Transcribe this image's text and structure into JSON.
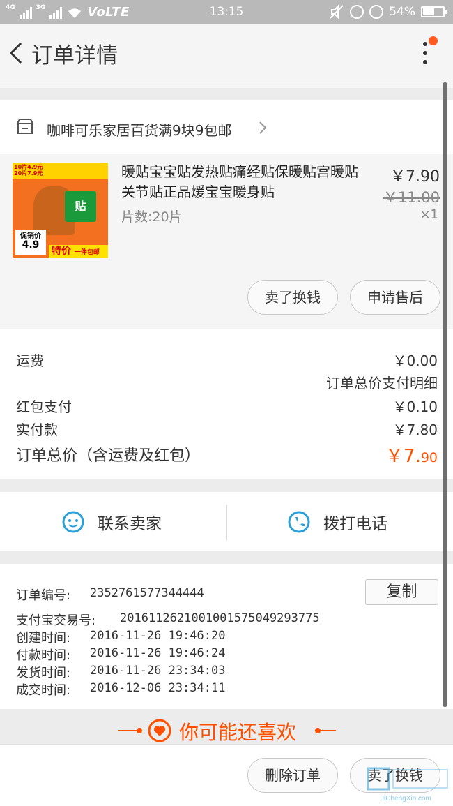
{
  "status_bar": {
    "network_left": "4G",
    "network_right": "3G",
    "volte": "VoLTE",
    "time": "13:15",
    "battery": "54%",
    "battery_level": 0.54
  },
  "header": {
    "title": "订单详情"
  },
  "shop": {
    "name": "咖啡可乐家居百货满9块9包邮"
  },
  "product": {
    "image_texts": {
      "line1": "10片4.9元",
      "line2": "20片7.9元",
      "brand": "智暖家族",
      "tie": "贴",
      "promo_label": "促销价",
      "promo_price": "4.9",
      "special": "特价",
      "special_sub": "一件包邮"
    },
    "title": "暖贴宝宝贴发热贴痛经贴保暖贴宫暖贴关节贴正品煖宝宝暖身贴",
    "spec": "片数:20片",
    "price": "￥7.90",
    "original_price": "￥11.00",
    "quantity": "×1",
    "sell_button": "卖了换钱",
    "refund_button": "申请售后"
  },
  "totals": {
    "shipping_label": "运费",
    "shipping_value": "￥0.00",
    "detail_link": "订单总价支付明细",
    "redpacket_label": "红包支付",
    "redpacket_value": "￥0.10",
    "paid_label": "实付款",
    "paid_value": "￥7.80",
    "total_label": "订单总价（含运费及红包）",
    "total_value_main": "￥7.",
    "total_value_cents": "90",
    "accent_color": "#ff5000"
  },
  "contact": {
    "seller_label": "联系卖家",
    "phone_label": "拨打电话",
    "icon_color": "#2a9fd8"
  },
  "order_info": {
    "order_no_label": "订单编号:",
    "order_no": "2352761577344444",
    "copy_button": "复制",
    "alipay_label": "支付宝交易号:",
    "alipay_no": "2016112621001001575049293775",
    "created_label": "创建时间:",
    "created": "2016-11-26 19:46:20",
    "paid_label": "付款时间:",
    "paid": "2016-11-26 19:46:24",
    "shipped_label": "发货时间:",
    "shipped": "2016-11-26 23:34:03",
    "done_label": "成交时间:",
    "done": "2016-12-06 23:34:11"
  },
  "recommend": {
    "title": "你可能还喜欢"
  },
  "bottom_bar": {
    "delete_button": "删除订单",
    "sell_button": "卖了换钱"
  },
  "watermark": {
    "text": "JiChengXin.com"
  }
}
